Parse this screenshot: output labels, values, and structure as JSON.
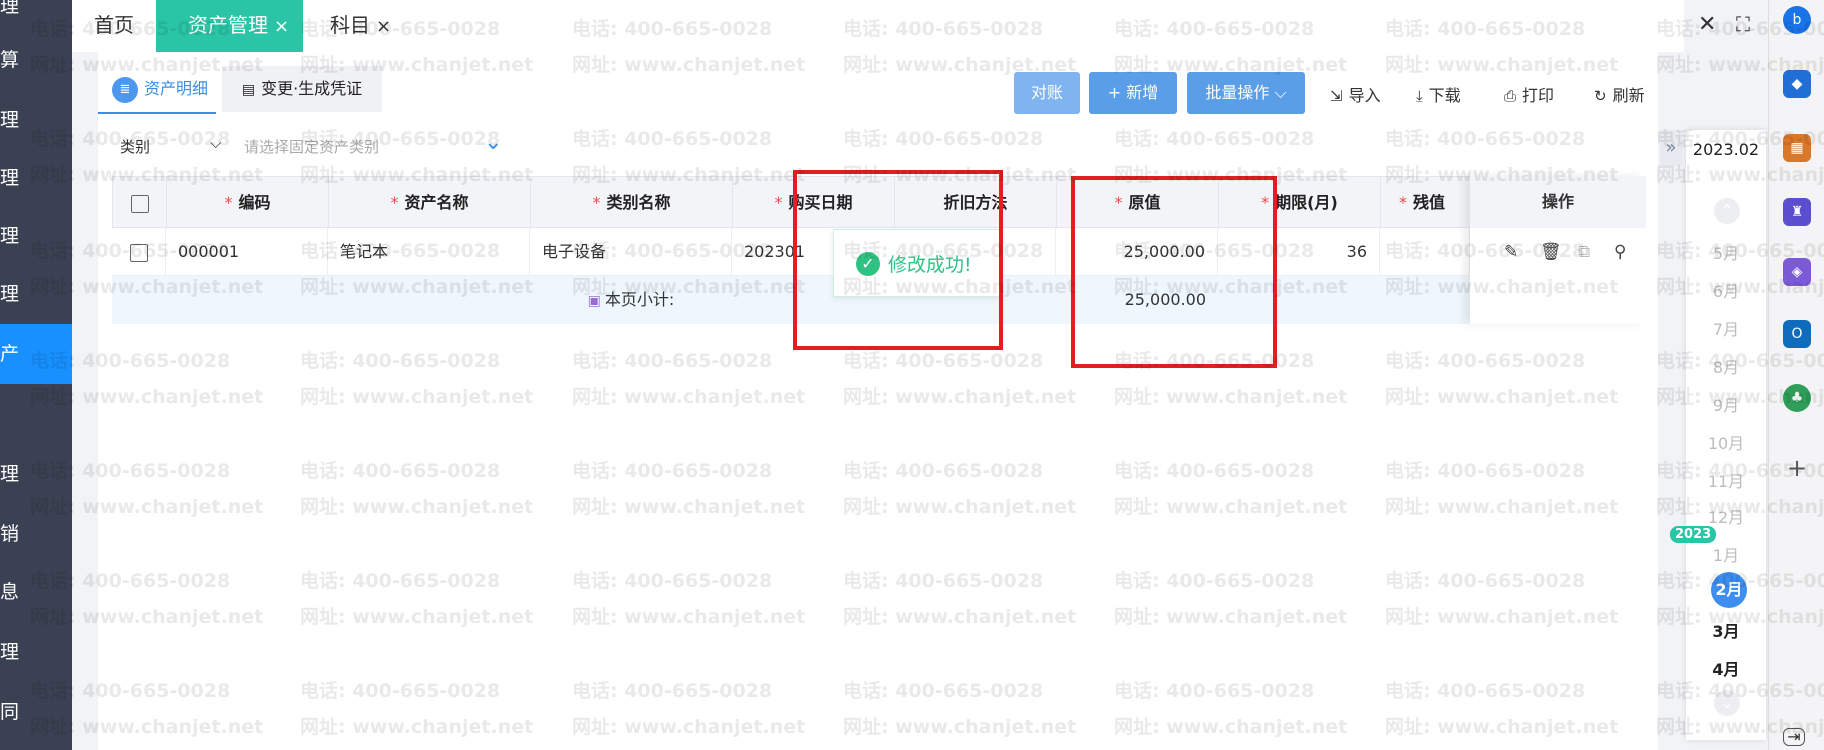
{
  "sidebar": {
    "items": [
      "理",
      "算",
      "理",
      "理",
      "理",
      "理",
      "产",
      "理",
      "销",
      "息",
      "理",
      "同"
    ]
  },
  "tabs": [
    {
      "label": "首页"
    },
    {
      "label": "资产管理",
      "close": "×"
    },
    {
      "label": "科目",
      "close": "×"
    }
  ],
  "window": {
    "close": "✕",
    "fullscreen": "⛶"
  },
  "subtabs": {
    "detail": "资产明细",
    "voucher": "变更·生成凭证"
  },
  "toolbar": {
    "reconcile": "对账",
    "add": "+ 新增",
    "batch": "批量操作",
    "import": "导入",
    "download": "下载",
    "print": "打印",
    "refresh": "刷新"
  },
  "filter": {
    "label": "类别",
    "placeholder": "请选择固定资产类别"
  },
  "table": {
    "headers": {
      "code": "编码",
      "name": "资产名称",
      "category": "类别名称",
      "purchase_date": "购买日期",
      "depreciation": "折旧方法",
      "original_value": "原值",
      "period": "期限(月)",
      "residual": "残值",
      "actions": "操作"
    },
    "rows": [
      {
        "code": "000001",
        "name": "笔记本",
        "category": "电子设备",
        "purchase_date": "202301",
        "original_value": "25,000.00",
        "period": "36"
      }
    ],
    "subtotal": {
      "label": "本页小计:",
      "original_value": "25,000.00"
    }
  },
  "toast": {
    "message": "修改成功!"
  },
  "watermark": {
    "phone": "电话: 400-665-0028",
    "site": "网址: www.chanjet.net"
  },
  "period_picker": {
    "current": "2023.02",
    "year_badge": "2023",
    "months": [
      "5月",
      "6月",
      "7月",
      "8月",
      "9月",
      "10月",
      "11月",
      "12月",
      "1月",
      "2月",
      "3月",
      "4月"
    ],
    "selected": "2月"
  },
  "colors": {
    "accent": "#2ac5a6",
    "primary": "#3d8ef0",
    "highlight": "#e02020",
    "success": "#2ec384"
  }
}
